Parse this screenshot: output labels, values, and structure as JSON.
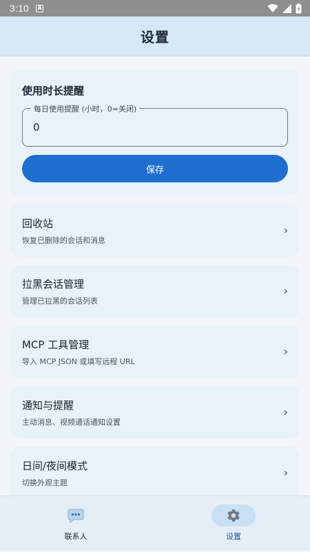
{
  "status_bar": {
    "time": "3:10",
    "notification_letter": "A"
  },
  "app_bar": {
    "title": "设置"
  },
  "reminder": {
    "title": "使用时长提醒",
    "field_label": "每日使用提醒 (小时，0=关闭)",
    "field_value": "0",
    "save_label": "保存"
  },
  "menu": [
    {
      "title": "回收站",
      "subtitle": "恢复已删除的会话和消息"
    },
    {
      "title": "拉黑会话管理",
      "subtitle": "管理已拉黑的会话列表"
    },
    {
      "title": "MCP 工具管理",
      "subtitle": "导入 MCP JSON 或填写远程 URL"
    },
    {
      "title": "通知与提醒",
      "subtitle": "主动消息、视频通话通知设置"
    },
    {
      "title": "日间/夜间模式",
      "subtitle": "切换外观主题"
    }
  ],
  "chevron": "›",
  "bottom_nav": {
    "contacts_label": "联系人",
    "settings_label": "设置"
  },
  "colors": {
    "accent": "#1f6fd1",
    "app_bar": "#d6e8f6",
    "card": "#e9f1f9"
  },
  "icons": {
    "contacts": "chat-bubble-icon",
    "settings": "gear-icon"
  }
}
